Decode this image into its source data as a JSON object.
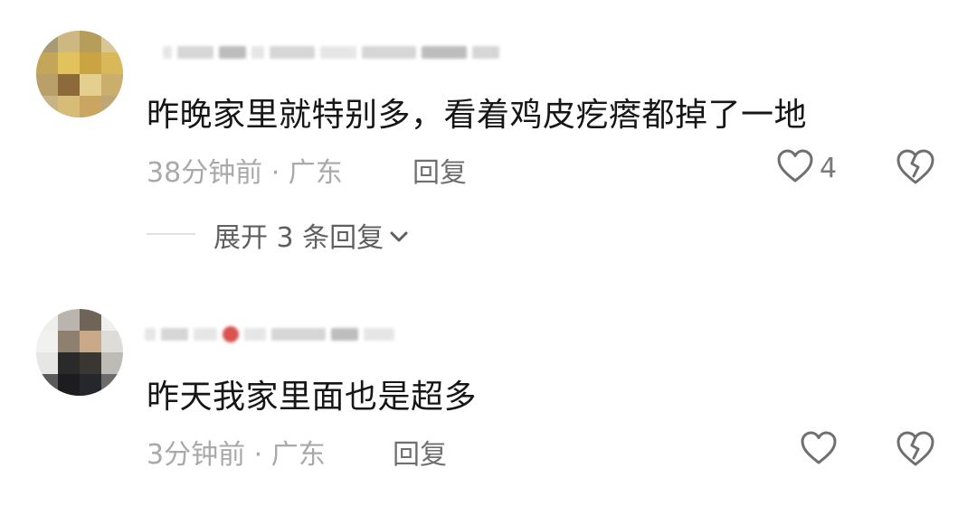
{
  "comments": [
    {
      "text": "昨晚家里就特别多，看着鸡皮疙瘩都掉了一地",
      "time_location": "38分钟前 · 广东",
      "reply_label": "回复",
      "like_count": "4",
      "expand_label": "展开 3 条回复"
    },
    {
      "text": "昨天我家里面也是超多",
      "time_location": "3分钟前 · 广东",
      "reply_label": "回复",
      "like_count": ""
    }
  ],
  "icons": {
    "like": "heart-outline-icon",
    "dislike": "broken-heart-icon",
    "expand": "chevron-down-icon"
  },
  "colors": {
    "text": "#161616",
    "meta": "#a9a9a9",
    "icon": "#6f6f6f"
  }
}
